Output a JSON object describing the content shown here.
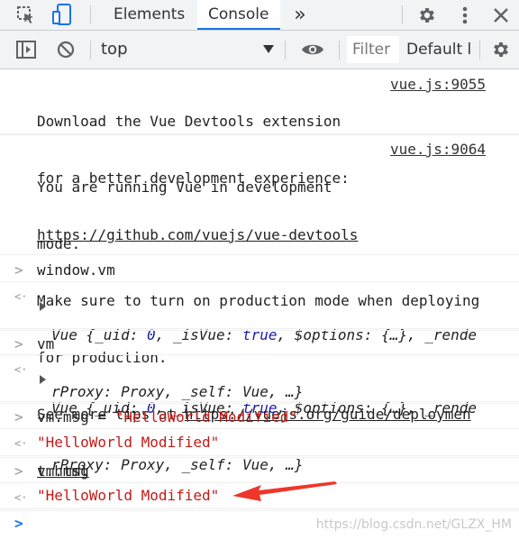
{
  "tabbar": {
    "tabs": [
      {
        "label": "Elements"
      },
      {
        "label": "Console"
      }
    ],
    "more_label": "»",
    "icons": [
      "inspect-cursor-icon",
      "device-toggle-icon",
      "gear-icon",
      "kebab-menu-icon",
      "close-icon"
    ]
  },
  "toolbar": {
    "context": "top",
    "filter_placeholder": "Filter",
    "levels_label": "Default l"
  },
  "messages": [
    {
      "type": "log",
      "lines": [
        "Download the Vue Devtools extension",
        "for a better development experience:"
      ],
      "link": "https://github.com/vuejs/vue-devtools",
      "source": "vue.js:9055"
    },
    {
      "type": "log",
      "lines": [
        "You are running Vue in development",
        "mode.",
        "Make sure to turn on production mode when deploying",
        "for production."
      ],
      "tip_prefix": "See more tips at ",
      "link_part1": "https://vuejs.org/guide/deploymen",
      "link_part2": "t.html",
      "source": "vue.js:9064"
    }
  ],
  "entries": [
    {
      "input": "window.vm"
    },
    {
      "input": "vm"
    },
    {
      "input_left": "vm.msg = ",
      "input_string": "\"HelloWorld Modified\"",
      "output": "\"HelloWorld Modified\""
    },
    {
      "input": "vm.msg",
      "output": "\"HelloWorld Modified\""
    }
  ],
  "vue_object": {
    "name": "Vue",
    "open": " {",
    "uid_key": "_uid",
    "uid_val": "0",
    "isvue_key": "_isVue",
    "isvue_val": "true",
    "options_key": "$options",
    "options_val": "{…}",
    "render_key_part": "_rende",
    "render_key_rest": "rProxy",
    "render_val": "Proxy",
    "self_key": "_self",
    "self_val": "Vue",
    "tail": "…}"
  },
  "prompt_symbol": ">",
  "result_symbol": "<·",
  "watermark": "https://blog.csdn.net/GLZX_HM"
}
